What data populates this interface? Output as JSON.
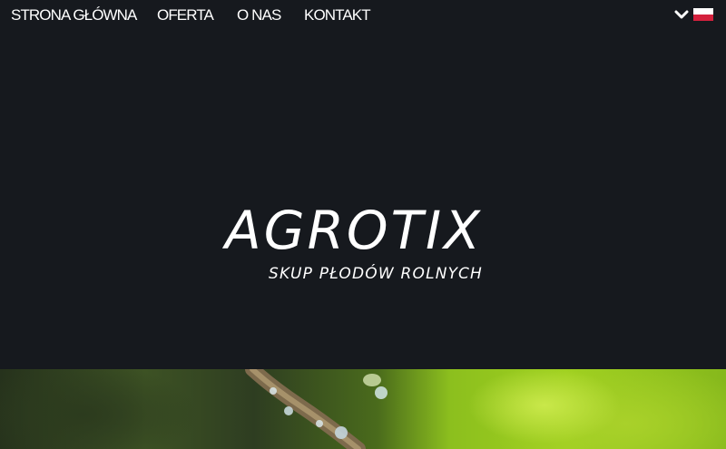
{
  "nav": {
    "items": [
      {
        "label": "STRONA GŁÓWNA"
      },
      {
        "label": "OFERTA"
      },
      {
        "label": "O NAS"
      },
      {
        "label": "KONTAKT"
      }
    ]
  },
  "language": {
    "icon": "chevron-down-icon",
    "flag": "poland-flag-icon",
    "colors": {
      "top": "#ffffff",
      "bottom": "#d4213d"
    }
  },
  "hero": {
    "logo_text": "AGROTIX",
    "tagline": "SKUP PŁODÓW ROLNYCH"
  },
  "colors": {
    "background": "#16191e",
    "text": "#ffffff"
  }
}
